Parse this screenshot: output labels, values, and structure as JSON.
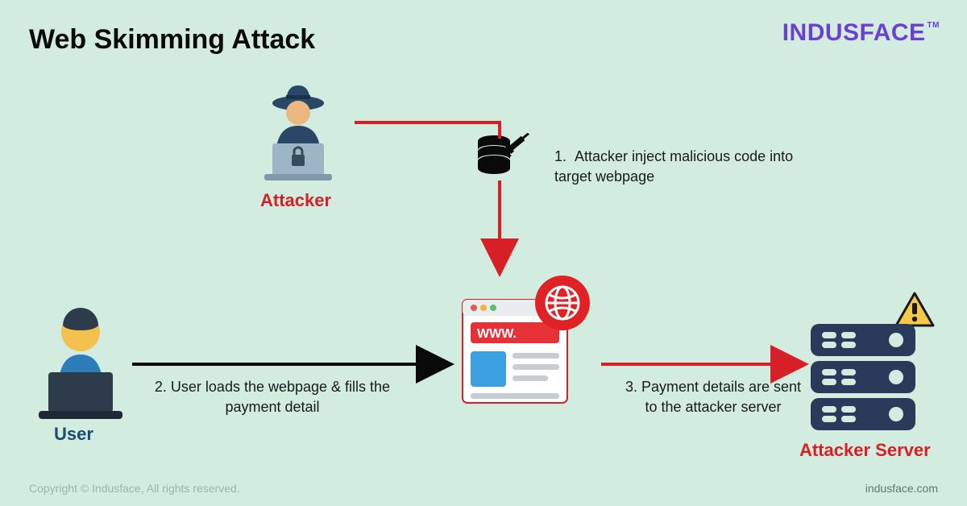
{
  "title": "Web Skimming Attack",
  "brand": "INDUSFACE",
  "brand_tm": "TM",
  "copyright": "Copyright © Indusface, All rights reserved.",
  "site": "indusface.com",
  "labels": {
    "attacker": "Attacker",
    "user": "User",
    "server": "Attacker Server"
  },
  "steps": {
    "s1_prefix": "1.",
    "s1": "Attacker inject malicious code into target webpage",
    "s2": "2. User loads the webpage & fills the payment detail",
    "s3": "3. Payment details are sent to the attacker server"
  },
  "colors": {
    "bg": "#d2ece0",
    "red": "#d61f26",
    "navy": "#1e4a6d",
    "brand": "#6b3fd4"
  }
}
